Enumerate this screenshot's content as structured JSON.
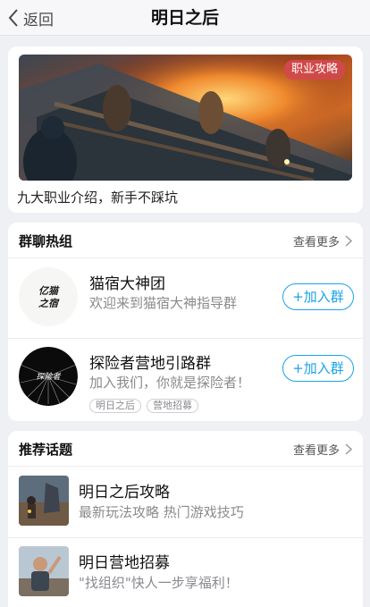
{
  "header": {
    "back_label": "返回",
    "title": "明日之后"
  },
  "banner": {
    "tag": "职业攻略",
    "caption": "九大职业介绍，新手不踩坑"
  },
  "groups": {
    "title": "群聊热组",
    "more_label": "查看更多",
    "items": [
      {
        "name": "猫宿大神团",
        "desc": "欢迎来到猫宿大神指导群",
        "avatar_text": "亿猫之宿",
        "join_label": "+加入群",
        "tags": []
      },
      {
        "name": "探险者营地引路群",
        "desc": "加入我们，你就是探险者！",
        "avatar_text": "探险者",
        "join_label": "+加入群",
        "tags": [
          "明日之后",
          "营地招募"
        ]
      }
    ]
  },
  "topics": {
    "title": "推荐话题",
    "more_label": "查看更多",
    "items": [
      {
        "name": "明日之后攻略",
        "desc": "最新玩法攻略 热门游戏技巧"
      },
      {
        "name": "明日营地招募",
        "desc": "\"找组织\"快人一步享福利！"
      }
    ]
  },
  "colors": {
    "accent": "#1aa3e6",
    "tag_bg": "#d3494e",
    "page_bg": "#eff0f4"
  }
}
